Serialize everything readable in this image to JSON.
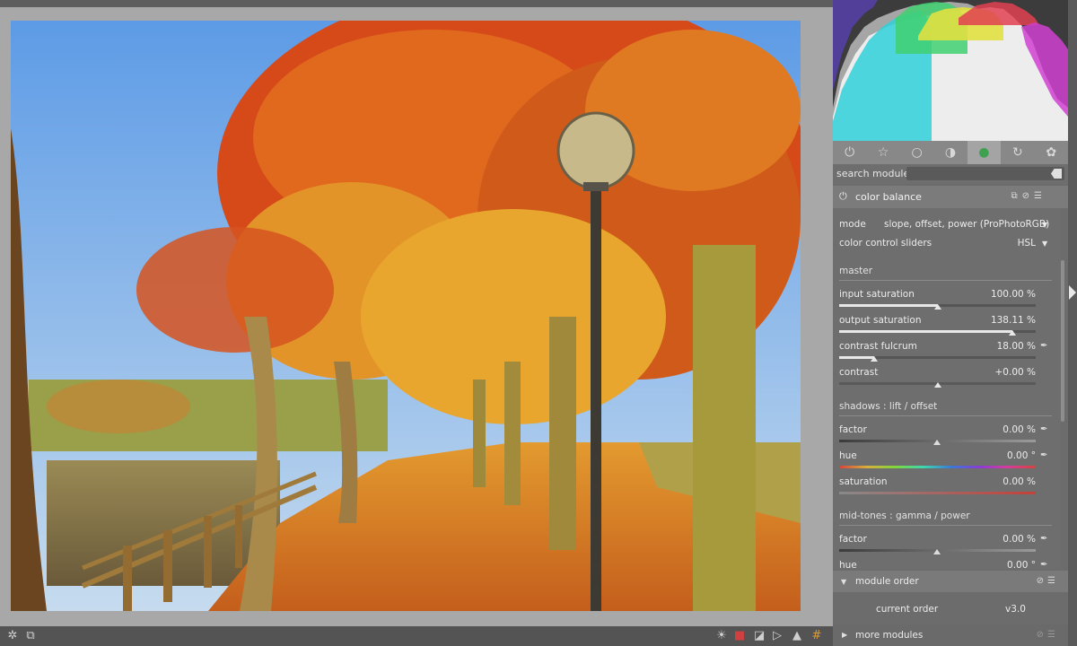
{
  "histogram": {
    "label": ""
  },
  "group_tabs": [
    {
      "name": "power-icon",
      "glyph": "⏻"
    },
    {
      "name": "star-icon",
      "glyph": "☆"
    },
    {
      "name": "circle-icon",
      "glyph": "○"
    },
    {
      "name": "tone-icon",
      "glyph": "◑"
    },
    {
      "name": "color-icon",
      "glyph": "●"
    },
    {
      "name": "correct-icon",
      "glyph": "↻"
    },
    {
      "name": "effect-icon",
      "glyph": "✿"
    }
  ],
  "search": {
    "label": "search module",
    "placeholder": ""
  },
  "module": {
    "title": "color balance",
    "mode_label": "mode",
    "mode_value": "slope, offset, power (ProPhotoRGB)",
    "sliders_label": "color control sliders",
    "sliders_value": "HSL",
    "master_section": "master",
    "input_saturation_label": "input saturation",
    "input_saturation_value": "100.00 %",
    "input_saturation_level": 0.5,
    "output_saturation_label": "output saturation",
    "output_saturation_value": "138.11 %",
    "output_saturation_level": 0.88,
    "contrast_fulcrum_label": "contrast fulcrum",
    "contrast_fulcrum_value": "18.00 %",
    "contrast_fulcrum_level": 0.18,
    "contrast_label": "contrast",
    "contrast_value": "+0.00 %",
    "contrast_level": 0.5,
    "shadows_section": "shadows : lift / offset",
    "sh_factor_label": "factor",
    "sh_factor_value": "0.00 %",
    "sh_hue_label": "hue",
    "sh_hue_value": "0.00 °",
    "sh_sat_label": "saturation",
    "sh_sat_value": "0.00 %",
    "mid_section": "mid-tones : gamma / power",
    "mid_factor_label": "factor",
    "mid_factor_value": "0.00 %",
    "mid_hue_label": "hue",
    "mid_hue_value": "0.00 °"
  },
  "module_order": {
    "title": "module order",
    "current_label": "current order",
    "current_value": "v3.0"
  },
  "more_modules": {
    "title": "more modules"
  },
  "colors": {
    "panel": "#6e6e6e",
    "center_bg": "#a8a8a8",
    "accent": "#e8e8e8"
  }
}
